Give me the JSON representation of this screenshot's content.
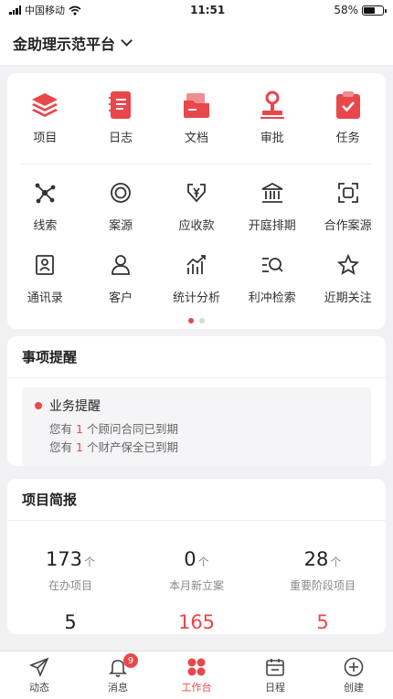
{
  "status_bar": {
    "carrier": "中国移动",
    "time": "11:51",
    "battery_text": "58%",
    "battery_level": 0.58
  },
  "header": {
    "title": "金助理示范平台"
  },
  "quick_grid": {
    "primary": [
      {
        "label": "项目",
        "icon": "layers-icon"
      },
      {
        "label": "日志",
        "icon": "notebook-icon"
      },
      {
        "label": "文档",
        "icon": "folder-icon"
      },
      {
        "label": "审批",
        "icon": "stamp-icon"
      },
      {
        "label": "任务",
        "icon": "clipboard-check-icon"
      }
    ],
    "secondary": [
      {
        "label": "线索",
        "icon": "network-icon"
      },
      {
        "label": "案源",
        "icon": "target-icon"
      },
      {
        "label": "应收款",
        "icon": "yuan-inbox-icon"
      },
      {
        "label": "开庭排期",
        "icon": "courthouse-icon"
      },
      {
        "label": "合作案源",
        "icon": "scan-icon"
      },
      {
        "label": "通讯录",
        "icon": "contact-book-icon"
      },
      {
        "label": "客户",
        "icon": "user-icon"
      },
      {
        "label": "统计分析",
        "icon": "bar-chart-icon"
      },
      {
        "label": "利冲检索",
        "icon": "list-search-icon"
      },
      {
        "label": "近期关注",
        "icon": "star-icon"
      }
    ],
    "pages": 2,
    "active_page": 1
  },
  "reminders": {
    "title": "事项提醒",
    "group_title": "业务提醒",
    "lines": [
      {
        "prefix": "您有",
        "count": "1",
        "suffix": "个顾问合同已到期"
      },
      {
        "prefix": "您有",
        "count": "1",
        "suffix": "个财产保全已到期"
      }
    ]
  },
  "project_report": {
    "title": "项目简报",
    "stats": [
      {
        "value": "173",
        "unit": "个",
        "caption": "在办项目"
      },
      {
        "value": "0",
        "unit": "个",
        "caption": "本月新立案"
      },
      {
        "value": "28",
        "unit": "个",
        "caption": "重要阶段项目"
      }
    ],
    "stats_row2": [
      "5",
      "165",
      "5"
    ]
  },
  "tabbar": {
    "tabs": [
      {
        "label": "动态",
        "icon": "send-icon"
      },
      {
        "label": "消息",
        "icon": "bell-icon",
        "badge": "9"
      },
      {
        "label": "工作台",
        "icon": "workbench-icon"
      },
      {
        "label": "日程",
        "icon": "calendar-icon"
      },
      {
        "label": "创建",
        "icon": "plus-circle-icon"
      }
    ],
    "active": "工作台"
  },
  "colors": {
    "accent": "#e8474c",
    "text": "#222222",
    "muted": "#888888"
  }
}
